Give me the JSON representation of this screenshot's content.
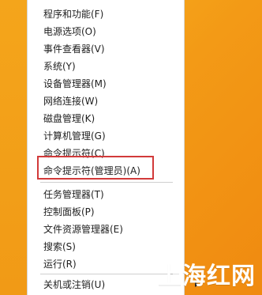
{
  "menu": {
    "items": [
      {
        "label": "程序和功能(F)"
      },
      {
        "label": "电源选项(O)"
      },
      {
        "label": "事件查看器(V)"
      },
      {
        "label": "系统(Y)"
      },
      {
        "label": "设备管理器(M)"
      },
      {
        "label": "网络连接(W)"
      },
      {
        "label": "磁盘管理(K)"
      },
      {
        "label": "计算机管理(G)"
      },
      {
        "label": "命令提示符(C)"
      },
      {
        "label": "命令提示符(管理员)(A)"
      },
      {
        "label": "任务管理器(T)"
      },
      {
        "label": "控制面板(P)"
      },
      {
        "label": "文件资源管理器(E)"
      },
      {
        "label": "搜索(S)"
      },
      {
        "label": "运行(R)"
      },
      {
        "label": "关机或注销(U)"
      }
    ],
    "submenu_arrow": "▸"
  },
  "watermark": {
    "text": "上海红网"
  },
  "colors": {
    "highlight": "#d23a3a",
    "menu_bg": "#ffffff",
    "background": "#f39a16"
  }
}
